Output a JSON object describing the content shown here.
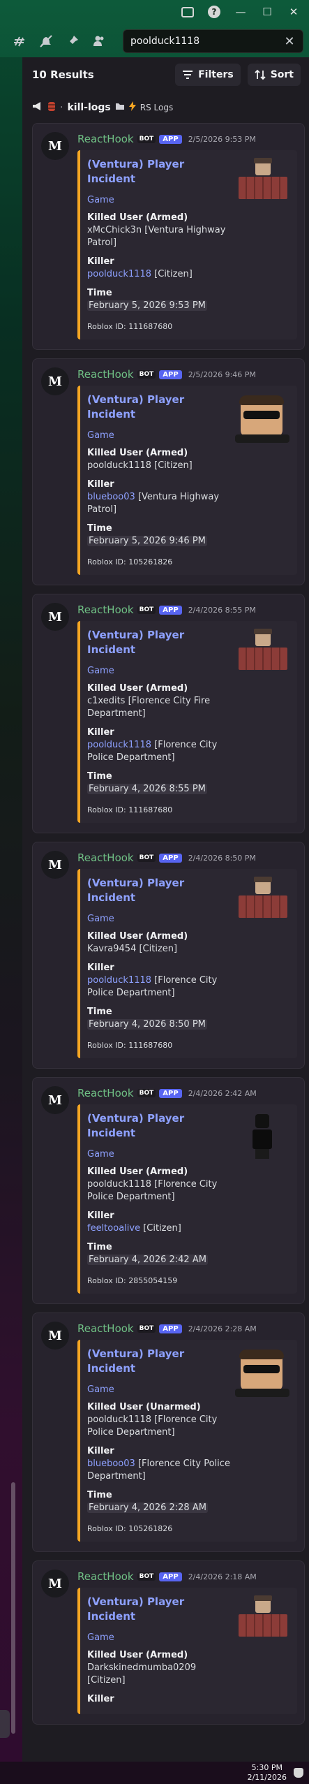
{
  "window": {
    "minimize": "—",
    "maximize": "☐",
    "close": "✕",
    "help": "?"
  },
  "search": {
    "query": "poolduck1118",
    "clear": "✕"
  },
  "header": {
    "results": "10 Results",
    "filters": "Filters",
    "sort": "Sort"
  },
  "channel": {
    "name": "kill-logs",
    "sub": "RS Logs"
  },
  "messages": [
    {
      "author": "ReactHook",
      "bot": "BOT",
      "app": "APP",
      "stamp": "2/5/2026 9:53 PM",
      "title": "(Ventura) Player Incident",
      "game": "Game",
      "killed_label": "Killed User (Armed)",
      "killed": "xMcChick3n [Ventura Highway Patrol]",
      "killer_label": "Killer",
      "killer_link": "poolduck1118",
      "killer_rest": " [Citizen]",
      "time_label": "Time",
      "time": "February 5, 2026 9:53 PM",
      "footer": "Roblox ID: 111687680",
      "thumb": "brick"
    },
    {
      "author": "ReactHook",
      "bot": "BOT",
      "app": "APP",
      "stamp": "2/5/2026 9:46 PM",
      "title": "(Ventura) Player Incident",
      "game": "Game",
      "killed_label": "Killed User (Armed)",
      "killed": "poolduck1118 [Citizen]",
      "killer_label": "Killer",
      "killer_link": "blueboo03",
      "killer_rest": " [Ventura Highway Patrol]",
      "time_label": "Time",
      "time": "February 5, 2026 9:46 PM",
      "footer": "Roblox ID: 105261826",
      "thumb": "face"
    },
    {
      "author": "ReactHook",
      "bot": "BOT",
      "app": "APP",
      "stamp": "2/4/2026 8:55 PM",
      "title": "(Ventura) Player Incident",
      "game": "Game",
      "killed_label": "Killed User (Armed)",
      "killed": "c1xedits [Florence City Fire Department]",
      "killer_label": "Killer",
      "killer_link": "poolduck1118",
      "killer_rest": " [Florence City Police Department]",
      "time_label": "Time",
      "time": "February 4, 2026 8:55 PM",
      "footer": "Roblox ID: 111687680",
      "thumb": "brick"
    },
    {
      "author": "ReactHook",
      "bot": "BOT",
      "app": "APP",
      "stamp": "2/4/2026 8:50 PM",
      "title": "(Ventura) Player Incident",
      "game": "Game",
      "killed_label": "Killed User (Armed)",
      "killed": "Kavra9454 [Citizen]",
      "killer_label": "Killer",
      "killer_link": "poolduck1118",
      "killer_rest": " [Florence City Police Department]",
      "time_label": "Time",
      "time": "February 4, 2026 8:50 PM",
      "footer": "Roblox ID: 111687680",
      "thumb": "brick"
    },
    {
      "author": "ReactHook",
      "bot": "BOT",
      "app": "APP",
      "stamp": "2/4/2026 2:42 AM",
      "title": "(Ventura) Player Incident",
      "game": "Game",
      "killed_label": "Killed User (Armed)",
      "killed": "poolduck1118 [Florence City Police Department]",
      "killer_label": "Killer",
      "killer_link": "feeltooalive",
      "killer_rest": " [Citizen]",
      "time_label": "Time",
      "time": "February 4, 2026 2:42 AM",
      "footer": "Roblox ID: 2855054159",
      "thumb": "dark"
    },
    {
      "author": "ReactHook",
      "bot": "BOT",
      "app": "APP",
      "stamp": "2/4/2026 2:28 AM",
      "title": "(Ventura) Player Incident",
      "game": "Game",
      "killed_label": "Killed User (Unarmed)",
      "killed": "poolduck1118 [Florence City Police Department]",
      "killer_label": "Killer",
      "killer_link": "blueboo03",
      "killer_rest": " [Florence City Police Department]",
      "time_label": "Time",
      "time": "February 4, 2026 2:28 AM",
      "footer": "Roblox ID: 105261826",
      "thumb": "face"
    },
    {
      "author": "ReactHook",
      "bot": "BOT",
      "app": "APP",
      "stamp": "2/4/2026 2:18 AM",
      "title": "(Ventura) Player Incident",
      "game": "Game",
      "killed_label": "Killed User (Armed)",
      "killed": "Darkskinedmumba0209 [Citizen]",
      "killer_label": "Killer",
      "killer_link": "",
      "killer_rest": "",
      "time_label": "",
      "time": "",
      "footer": "",
      "thumb": "brick"
    }
  ],
  "clock": {
    "time": "5:30 PM",
    "date": "2/11/2026"
  }
}
